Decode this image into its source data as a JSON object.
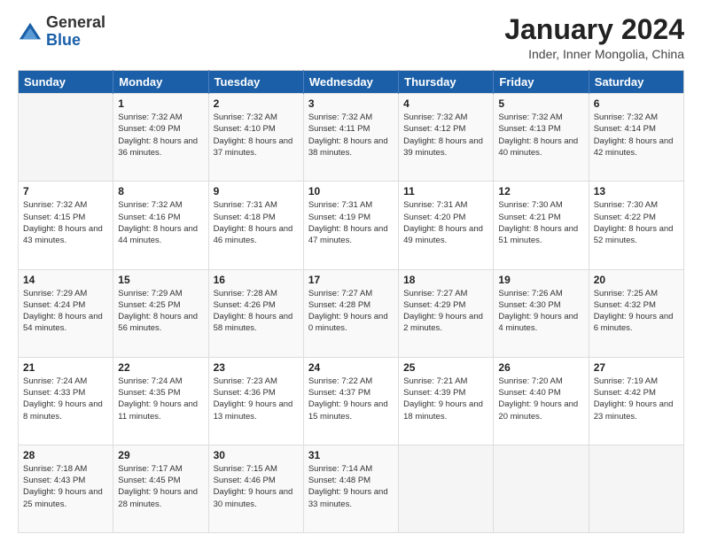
{
  "header": {
    "logo_general": "General",
    "logo_blue": "Blue",
    "title": "January 2024",
    "subtitle": "Inder, Inner Mongolia, China"
  },
  "weekdays": [
    "Sunday",
    "Monday",
    "Tuesday",
    "Wednesday",
    "Thursday",
    "Friday",
    "Saturday"
  ],
  "weeks": [
    [
      {
        "day": "",
        "info": ""
      },
      {
        "day": "1",
        "info": "Sunrise: 7:32 AM\nSunset: 4:09 PM\nDaylight: 8 hours and 36 minutes."
      },
      {
        "day": "2",
        "info": "Sunrise: 7:32 AM\nSunset: 4:10 PM\nDaylight: 8 hours and 37 minutes."
      },
      {
        "day": "3",
        "info": "Sunrise: 7:32 AM\nSunset: 4:11 PM\nDaylight: 8 hours and 38 minutes."
      },
      {
        "day": "4",
        "info": "Sunrise: 7:32 AM\nSunset: 4:12 PM\nDaylight: 8 hours and 39 minutes."
      },
      {
        "day": "5",
        "info": "Sunrise: 7:32 AM\nSunset: 4:13 PM\nDaylight: 8 hours and 40 minutes."
      },
      {
        "day": "6",
        "info": "Sunrise: 7:32 AM\nSunset: 4:14 PM\nDaylight: 8 hours and 42 minutes."
      }
    ],
    [
      {
        "day": "7",
        "info": "Sunrise: 7:32 AM\nSunset: 4:15 PM\nDaylight: 8 hours and 43 minutes."
      },
      {
        "day": "8",
        "info": "Sunrise: 7:32 AM\nSunset: 4:16 PM\nDaylight: 8 hours and 44 minutes."
      },
      {
        "day": "9",
        "info": "Sunrise: 7:31 AM\nSunset: 4:18 PM\nDaylight: 8 hours and 46 minutes."
      },
      {
        "day": "10",
        "info": "Sunrise: 7:31 AM\nSunset: 4:19 PM\nDaylight: 8 hours and 47 minutes."
      },
      {
        "day": "11",
        "info": "Sunrise: 7:31 AM\nSunset: 4:20 PM\nDaylight: 8 hours and 49 minutes."
      },
      {
        "day": "12",
        "info": "Sunrise: 7:30 AM\nSunset: 4:21 PM\nDaylight: 8 hours and 51 minutes."
      },
      {
        "day": "13",
        "info": "Sunrise: 7:30 AM\nSunset: 4:22 PM\nDaylight: 8 hours and 52 minutes."
      }
    ],
    [
      {
        "day": "14",
        "info": "Sunrise: 7:29 AM\nSunset: 4:24 PM\nDaylight: 8 hours and 54 minutes."
      },
      {
        "day": "15",
        "info": "Sunrise: 7:29 AM\nSunset: 4:25 PM\nDaylight: 8 hours and 56 minutes."
      },
      {
        "day": "16",
        "info": "Sunrise: 7:28 AM\nSunset: 4:26 PM\nDaylight: 8 hours and 58 minutes."
      },
      {
        "day": "17",
        "info": "Sunrise: 7:27 AM\nSunset: 4:28 PM\nDaylight: 9 hours and 0 minutes."
      },
      {
        "day": "18",
        "info": "Sunrise: 7:27 AM\nSunset: 4:29 PM\nDaylight: 9 hours and 2 minutes."
      },
      {
        "day": "19",
        "info": "Sunrise: 7:26 AM\nSunset: 4:30 PM\nDaylight: 9 hours and 4 minutes."
      },
      {
        "day": "20",
        "info": "Sunrise: 7:25 AM\nSunset: 4:32 PM\nDaylight: 9 hours and 6 minutes."
      }
    ],
    [
      {
        "day": "21",
        "info": "Sunrise: 7:24 AM\nSunset: 4:33 PM\nDaylight: 9 hours and 8 minutes."
      },
      {
        "day": "22",
        "info": "Sunrise: 7:24 AM\nSunset: 4:35 PM\nDaylight: 9 hours and 11 minutes."
      },
      {
        "day": "23",
        "info": "Sunrise: 7:23 AM\nSunset: 4:36 PM\nDaylight: 9 hours and 13 minutes."
      },
      {
        "day": "24",
        "info": "Sunrise: 7:22 AM\nSunset: 4:37 PM\nDaylight: 9 hours and 15 minutes."
      },
      {
        "day": "25",
        "info": "Sunrise: 7:21 AM\nSunset: 4:39 PM\nDaylight: 9 hours and 18 minutes."
      },
      {
        "day": "26",
        "info": "Sunrise: 7:20 AM\nSunset: 4:40 PM\nDaylight: 9 hours and 20 minutes."
      },
      {
        "day": "27",
        "info": "Sunrise: 7:19 AM\nSunset: 4:42 PM\nDaylight: 9 hours and 23 minutes."
      }
    ],
    [
      {
        "day": "28",
        "info": "Sunrise: 7:18 AM\nSunset: 4:43 PM\nDaylight: 9 hours and 25 minutes."
      },
      {
        "day": "29",
        "info": "Sunrise: 7:17 AM\nSunset: 4:45 PM\nDaylight: 9 hours and 28 minutes."
      },
      {
        "day": "30",
        "info": "Sunrise: 7:15 AM\nSunset: 4:46 PM\nDaylight: 9 hours and 30 minutes."
      },
      {
        "day": "31",
        "info": "Sunrise: 7:14 AM\nSunset: 4:48 PM\nDaylight: 9 hours and 33 minutes."
      },
      {
        "day": "",
        "info": ""
      },
      {
        "day": "",
        "info": ""
      },
      {
        "day": "",
        "info": ""
      }
    ]
  ]
}
